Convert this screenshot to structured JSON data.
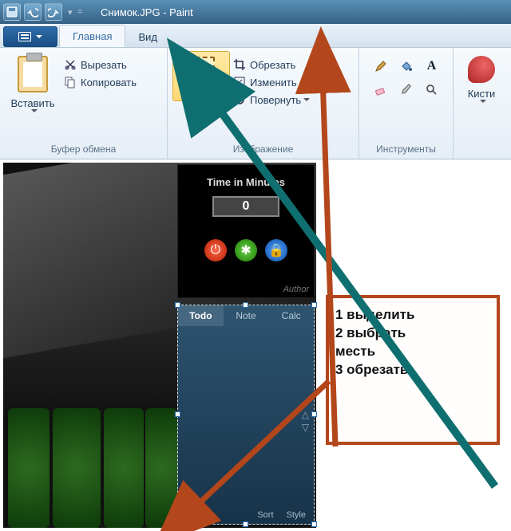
{
  "window": {
    "title": "Снимок.JPG - Paint"
  },
  "qat": {
    "items": [
      "save-icon",
      "undo-icon",
      "redo-icon"
    ],
    "separator": "▾"
  },
  "tabs": {
    "file_menu": "file-menu",
    "items": [
      {
        "id": "home",
        "label": "Главная",
        "active": true
      },
      {
        "id": "view",
        "label": "Вид",
        "active": false
      }
    ]
  },
  "ribbon": {
    "clipboard": {
      "group_label": "Буфер обмена",
      "paste": "Вставить",
      "cut": "Вырезать",
      "copy": "Копировать"
    },
    "image": {
      "group_label": "Изображение",
      "select": "Выдели",
      "crop": "Обрезать",
      "resize": "Изменить",
      "rotate": "Повернуть"
    },
    "tools": {
      "group_label": "Инструменты",
      "items": [
        "pencil",
        "fill",
        "text",
        "eraser",
        "picker",
        "magnifier"
      ]
    },
    "brushes": {
      "label": "Кисти"
    }
  },
  "gadget_timer": {
    "title": "Time in Minutes",
    "value": "0",
    "buttons": [
      "power",
      "start",
      "lock"
    ],
    "author": "Author"
  },
  "gadget_notes": {
    "tabs": [
      {
        "id": "todo",
        "label": "Todo",
        "active": true
      },
      {
        "id": "note",
        "label": "Note",
        "active": false
      },
      {
        "id": "calc",
        "label": "Calc",
        "active": false
      }
    ],
    "footer": {
      "sort": "Sort",
      "style": "Style"
    }
  },
  "annotation": {
    "line1": "1 выделить",
    "line2": "2 выбрать",
    "line3": "месть",
    "line4": "3 обрезать"
  }
}
